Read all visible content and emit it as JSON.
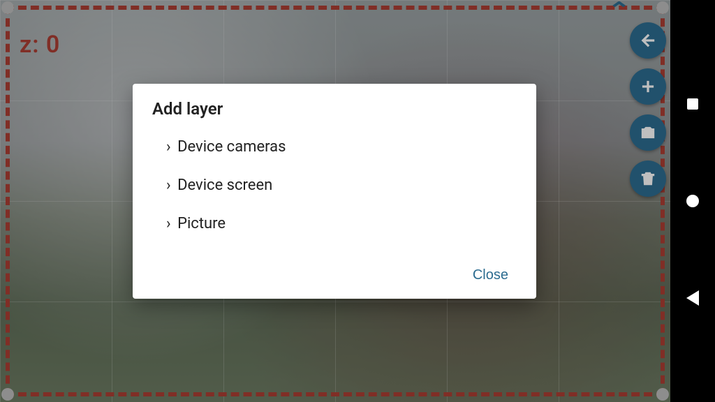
{
  "z_label": "z: 0",
  "fab": {
    "back": "back-arrow",
    "add": "plus",
    "flip": "flip-camera",
    "delete": "trash"
  },
  "dialog": {
    "title": "Add layer",
    "options": [
      "Device cameras",
      "Device screen",
      "Picture"
    ],
    "close_label": "Close"
  },
  "colors": {
    "accent": "#1f6f9c",
    "danger": "#c0392b"
  }
}
